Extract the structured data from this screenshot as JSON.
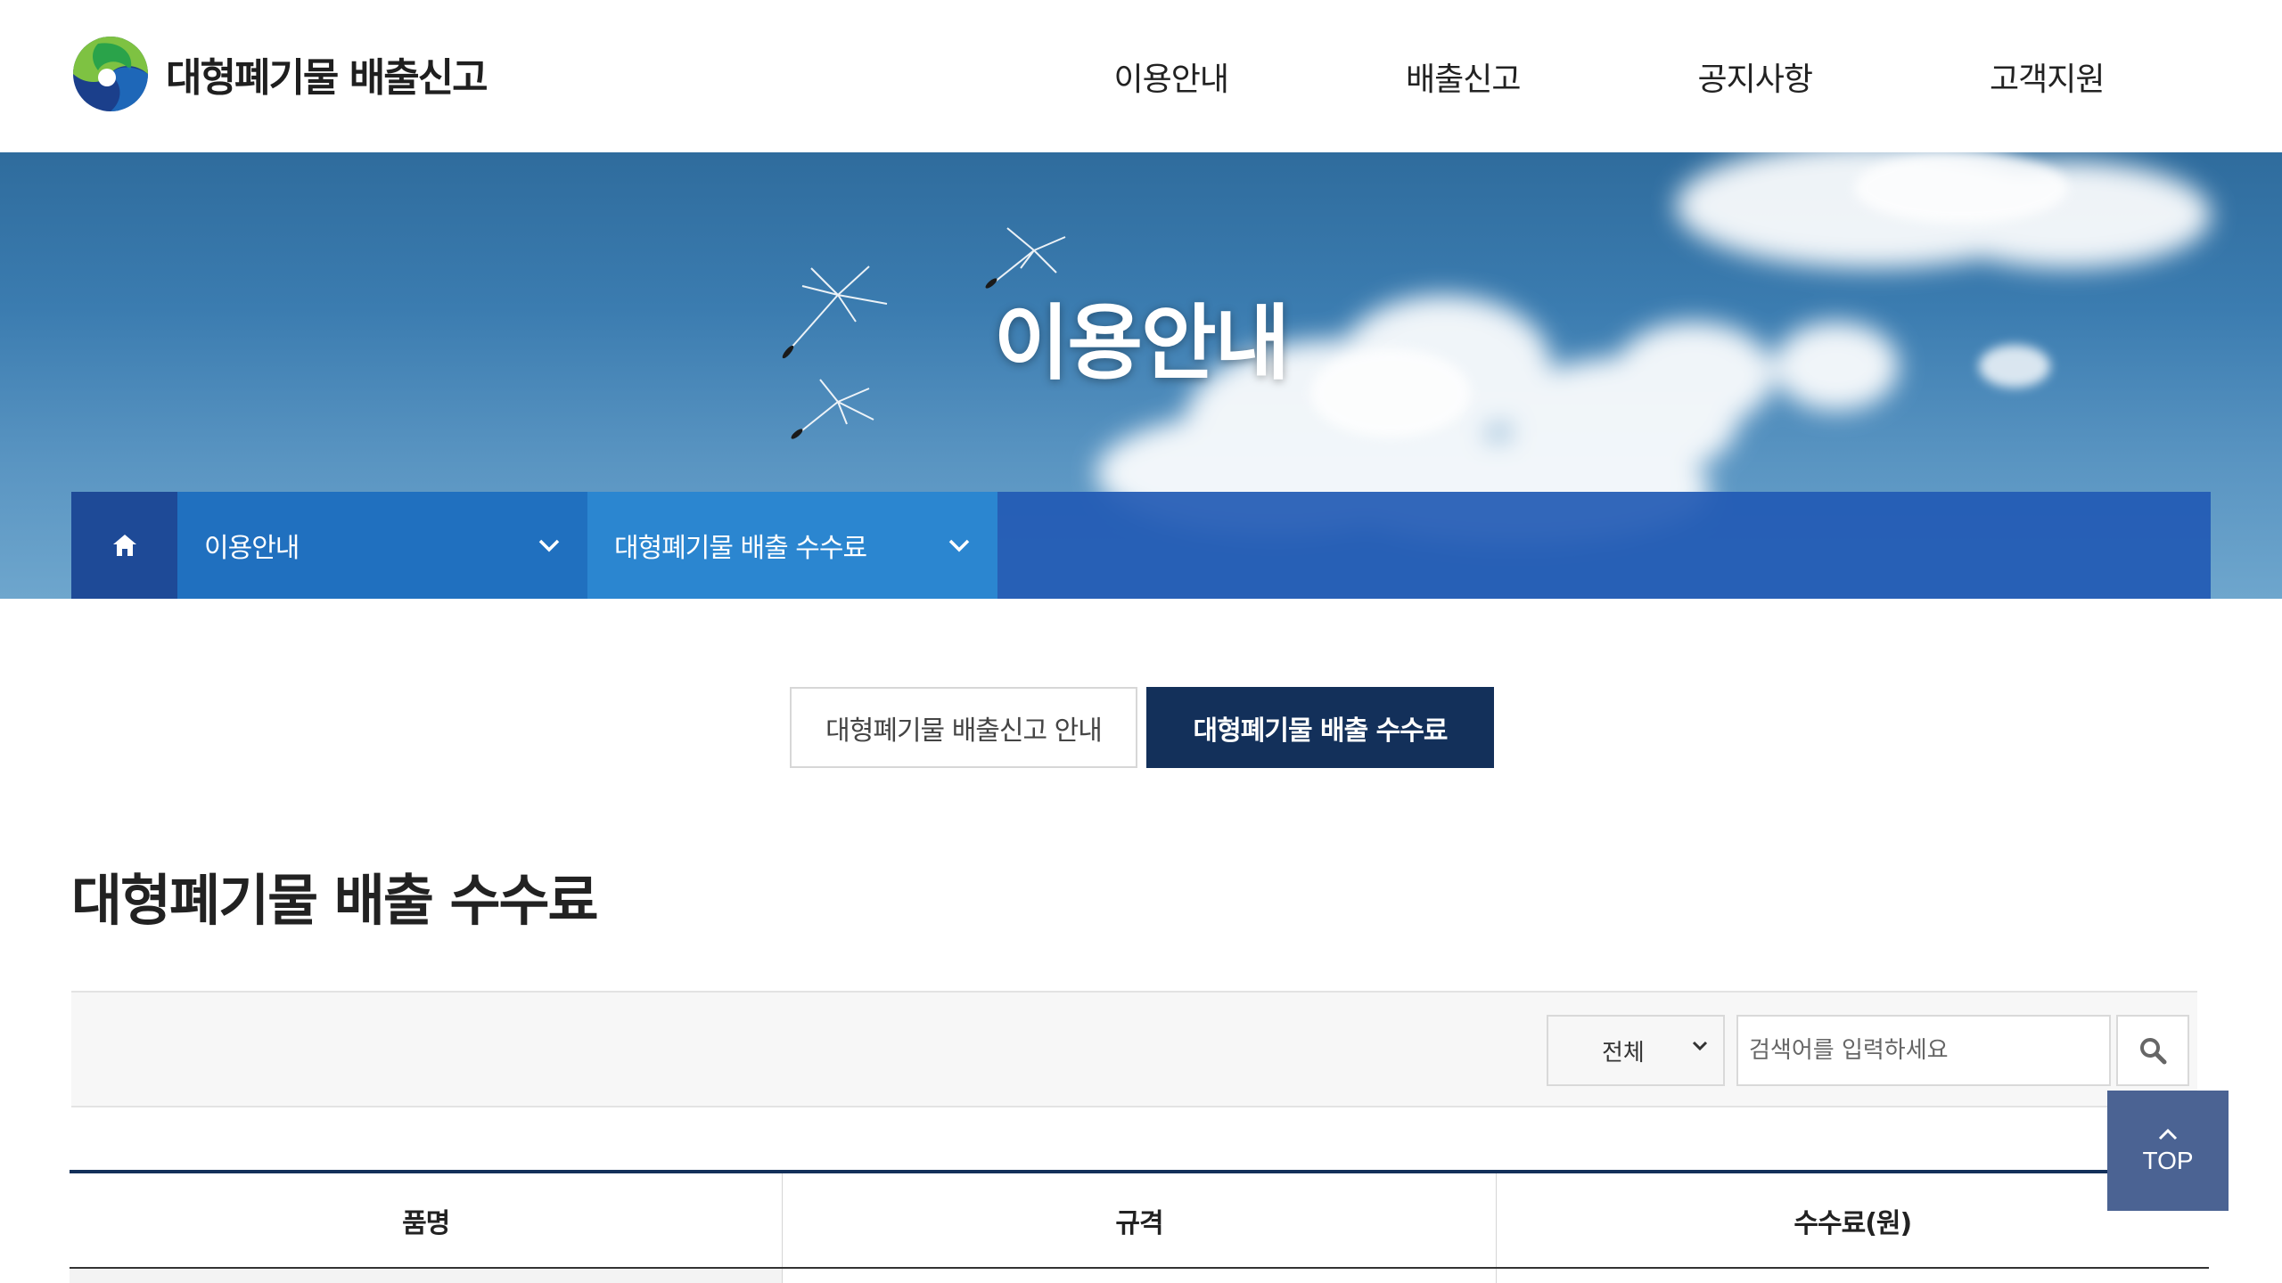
{
  "header": {
    "logo_text": "대형폐기물 배출신고",
    "nav": [
      "이용안내",
      "배출신고",
      "공지사항",
      "고객지원"
    ]
  },
  "visual": {
    "title": "이용안내"
  },
  "location": {
    "depth1": "이용안내",
    "depth2": "대형폐기물 배출 수수료"
  },
  "tabs": [
    {
      "label": "대형폐기물 배출신고 안내",
      "active": false
    },
    {
      "label": "대형폐기물 배출 수수료",
      "active": true
    }
  ],
  "content": {
    "title": "대형폐기물 배출 수수료"
  },
  "search": {
    "select_value": "전체",
    "placeholder": "검색어를 입력하세요"
  },
  "top_button": {
    "label": "TOP"
  },
  "table": {
    "headers": [
      "품명",
      "규격",
      "수수료(원)"
    ]
  },
  "colors": {
    "primary_navy": "#13305a",
    "location_bar": "#2070bf",
    "top_button": "#4b6393"
  }
}
